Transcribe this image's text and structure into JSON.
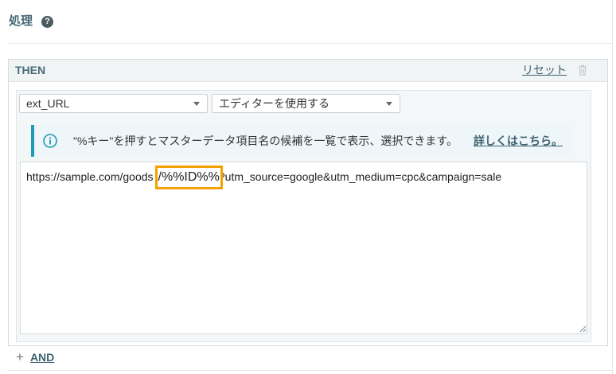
{
  "section": {
    "title": "処理",
    "help_icon": "question-circle-icon"
  },
  "panel": {
    "title": "THEN",
    "reset_label": "リセット",
    "delete_icon": "trash-icon",
    "field_select": {
      "value": "ext_URL"
    },
    "mode_select": {
      "value": "エディターを使用する"
    },
    "info": {
      "icon": "info-circle-icon",
      "message": "\"%キー\"を押すとマスターデータ項目名の候補を一覧で表示、選択できます。",
      "link_label": "詳しくはこちら。"
    },
    "editor": {
      "text_before": "https://sample.com/goods",
      "highlighted_text": "/%%ID%%",
      "text_after": "?utm_source=google&utm_medium=cpc&campaign=sale"
    }
  },
  "add_condition": {
    "icon": "plus-icon",
    "label": "AND"
  },
  "colors": {
    "accent": "#1e9bb4",
    "highlight": "#f4a100",
    "link": "#3e6170",
    "title": "#4a6b79"
  }
}
